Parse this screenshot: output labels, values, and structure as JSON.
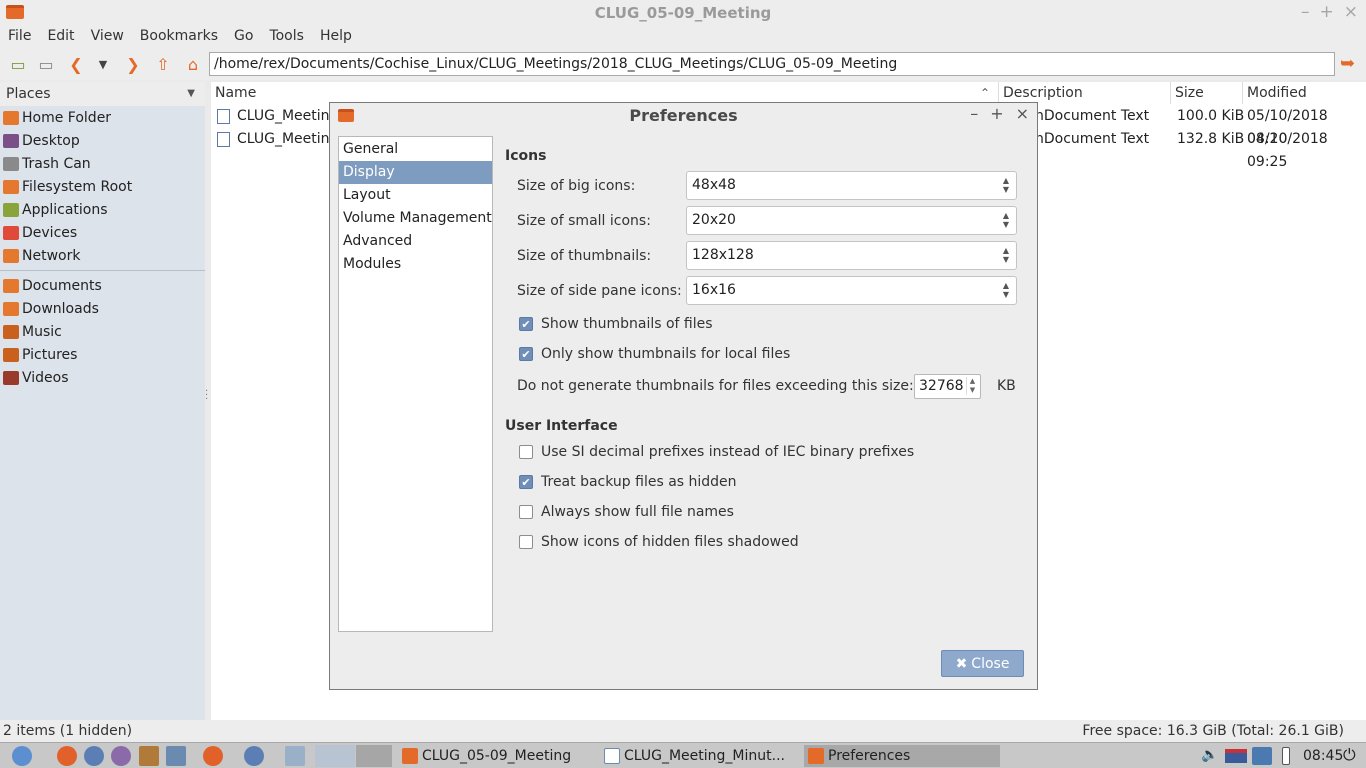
{
  "window": {
    "title": "CLUG_05-09_Meeting",
    "controls": [
      "–",
      "+",
      "×"
    ]
  },
  "menubar": [
    "File",
    "Edit",
    "View",
    "Bookmarks",
    "Go",
    "Tools",
    "Help"
  ],
  "toolbar": {
    "path": "/home/rex/Documents/Cochise_Linux/CLUG_Meetings/2018_CLUG_Meetings/CLUG_05-09_Meeting"
  },
  "sidepane": {
    "header": "Places",
    "places": [
      {
        "label": "Home Folder",
        "icon": "home-folder-icon",
        "color": "#e4782f"
      },
      {
        "label": "Desktop",
        "icon": "desktop-icon",
        "color": "#7b4f88"
      },
      {
        "label": "Trash Can",
        "icon": "trash-icon",
        "color": "#8a8a8a"
      },
      {
        "label": "Filesystem Root",
        "icon": "folder-icon",
        "color": "#e4782f"
      },
      {
        "label": "Applications",
        "icon": "applications-icon",
        "color": "#8aa43c"
      },
      {
        "label": "Devices",
        "icon": "devices-icon",
        "color": "#e04a3a"
      },
      {
        "label": "Network",
        "icon": "network-icon",
        "color": "#e4782f"
      }
    ],
    "bookmarks": [
      {
        "label": "Documents",
        "icon": "documents-icon",
        "color": "#e4782f"
      },
      {
        "label": "Downloads",
        "icon": "downloads-icon",
        "color": "#e4782f"
      },
      {
        "label": "Music",
        "icon": "music-icon",
        "color": "#c9601e"
      },
      {
        "label": "Pictures",
        "icon": "pictures-icon",
        "color": "#c9601e"
      },
      {
        "label": "Videos",
        "icon": "videos-icon",
        "color": "#9a3a2a"
      }
    ]
  },
  "filelist": {
    "columns": {
      "name": "Name",
      "description": "Description",
      "size": "Size",
      "modified": "Modified"
    },
    "rows": [
      {
        "name": "CLUG_Meetin",
        "description": "nDocument Text",
        "size": "100.0 KiB",
        "modified": "05/10/2018 08:20"
      },
      {
        "name": "CLUG_Meetin",
        "description": "nDocument Text",
        "size": "132.8 KiB",
        "modified": "04/10/2018 09:25"
      }
    ]
  },
  "statusbar": {
    "left": "2 items (1 hidden)",
    "right": "Free space: 16.3 GiB (Total: 26.1 GiB)"
  },
  "dialog": {
    "title": "Preferences",
    "nav": [
      "General",
      "Display",
      "Layout",
      "Volume Management",
      "Advanced",
      "Modules"
    ],
    "selected_nav": "Display",
    "icons_heading": "Icons",
    "size_rows": [
      {
        "label": "Size of big icons:",
        "value": "48x48"
      },
      {
        "label": "Size of small icons:",
        "value": "20x20"
      },
      {
        "label": "Size of thumbnails:",
        "value": "128x128"
      },
      {
        "label": "Size of side pane icons:",
        "value": "16x16"
      }
    ],
    "thumb_checks": [
      {
        "label": "Show thumbnails of files",
        "checked": true
      },
      {
        "label": "Only show thumbnails for local files",
        "checked": true
      }
    ],
    "thumb_limit_label": "Do not generate thumbnails for files exceeding this size:",
    "thumb_limit_value": "32768",
    "thumb_limit_unit": "KB",
    "ui_heading": "User Interface",
    "ui_checks": [
      {
        "label": "Use SI decimal prefixes instead of IEC binary prefixes",
        "checked": false
      },
      {
        "label": "Treat backup files as hidden",
        "checked": true
      },
      {
        "label": "Always show full file names",
        "checked": false
      },
      {
        "label": "Show icons of hidden files shadowed",
        "checked": false
      }
    ],
    "close_label": "Close"
  },
  "taskbar": {
    "tasks": [
      {
        "label": "CLUG_05-09_Meeting",
        "icon": "folder-icon"
      },
      {
        "label": "CLUG_Meeting_Minut...",
        "icon": "document-icon"
      },
      {
        "label": "Preferences",
        "icon": "preferences-icon"
      }
    ],
    "clock": "08:45"
  }
}
